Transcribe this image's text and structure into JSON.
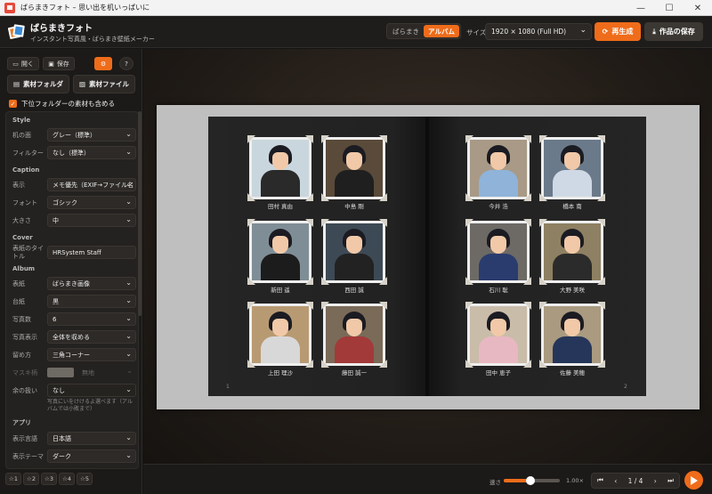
{
  "window": {
    "title": "ばらまきフォト – 思い出を机いっぱいに",
    "minimize": "—",
    "maximize": "☐",
    "close": "✕"
  },
  "header": {
    "app_name": "ばらまきフォト",
    "app_subtitle": "インスタント写真風・ばらまき壁紙メーカー",
    "mode_scatter": "ばらまき",
    "mode_album": "アルバム",
    "size_label": "サイズ",
    "size_value": "1920 × 1080 (Full HD)",
    "regen_label": "再生成",
    "save_label": "作品の保存"
  },
  "sidebar": {
    "open_label": "開く",
    "save_label": "保存",
    "folder_label": "素材フォルダ",
    "file_label": "素材ファイル",
    "include_sub_label": "下位フォルダーの素材も含める",
    "style_title": "Style",
    "desk_label": "机の面",
    "desk_value": "グレー（標準）",
    "filter_label": "フィルター",
    "filter_value": "なし（標準）",
    "caption_title": "Caption",
    "display_label": "表示",
    "display_value": "メモ優先（EXIF→ファイル名",
    "font_label": "フォント",
    "font_value": "ゴシック",
    "size_label": "大きさ",
    "size_value": "中",
    "cover_title": "Cover",
    "cover_title_label": "表紙のタイトル",
    "cover_title_value": "HRSystem Staff",
    "album_title": "Album",
    "cover_label": "表紙",
    "cover_value": "ばらまき画像",
    "mount_label": "台紙",
    "mount_value": "黒",
    "count_label": "写真数",
    "count_value": "6",
    "photo_display_label": "写真表示",
    "photo_display_value": "全体を収める",
    "fasten_label": "留め方",
    "fasten_value": "三角コーナー",
    "tape_label": "マスキ柄",
    "tape_value": "無地",
    "surplus_label": "余の扱い",
    "surplus_value": "なし",
    "surplus_note": "写真にいをけけるよ選べます（アルバムでは小敗まで）",
    "app_title": "アプリ",
    "lang_label": "表示言語",
    "lang_value": "日本語",
    "theme_label": "表示テーマ",
    "theme_value": "ダーク",
    "stars": [
      "☆1",
      "☆2",
      "☆3",
      "☆4",
      "☆5"
    ]
  },
  "album": {
    "page_left": "1",
    "page_right": "2",
    "photos_left": [
      {
        "name": "田村 真由",
        "body": "#2a2a2a",
        "wall": "#c9d6dd"
      },
      {
        "name": "中島 剛",
        "body": "#1f1f1f",
        "wall": "#5a4a3a"
      },
      {
        "name": "新田 遥",
        "body": "#1c1c1c",
        "wall": "#7f8e96"
      },
      {
        "name": "西田 誠",
        "body": "#222",
        "wall": "#3d4a55"
      },
      {
        "name": "上田 理沙",
        "body": "#d8d8d8",
        "wall": "#b89a72"
      },
      {
        "name": "藤田 誠一",
        "body": "#a23a3a",
        "wall": "#7a6a58"
      }
    ],
    "photos_right": [
      {
        "name": "今井 浩",
        "body": "#8fb3d9",
        "wall": "#a89a86"
      },
      {
        "name": "橋本 南",
        "body": "#cfd9e6",
        "wall": "#6a7a8a"
      },
      {
        "name": "石川 聡",
        "body": "#2a3c6e",
        "wall": "#6d6a66"
      },
      {
        "name": "大野 美咲",
        "body": "#2b2b2b",
        "wall": "#8e8062"
      },
      {
        "name": "田中 恵子",
        "body": "#e8b8c2",
        "wall": "#c9bca9"
      },
      {
        "name": "佐藤 美穂",
        "body": "#26365a",
        "wall": "#a99a80"
      }
    ]
  },
  "footer": {
    "speed_label": "速さ",
    "speed_value": "1.00×",
    "speed_fraction": 0.47,
    "page_indicator": "1 / 4",
    "first": "⏮",
    "prev": "‹",
    "next": "›",
    "last": "⏭"
  }
}
